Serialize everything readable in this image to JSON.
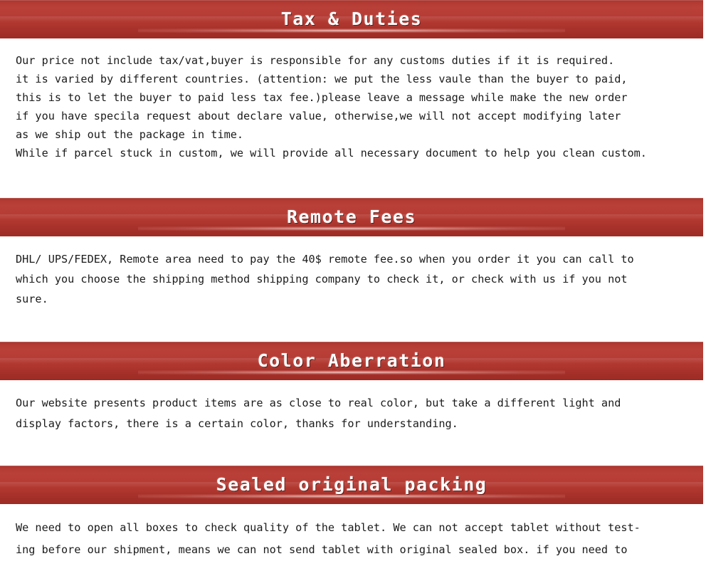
{
  "page": {
    "background_color": "#ffffff",
    "banner_color": "#b23a32",
    "banner_text_color": "#ffffff",
    "body_text_color": "#1b1b1b"
  },
  "sections": [
    {
      "id": "tax-and-duties",
      "title": "Tax & Duties",
      "lines": [
        "Our price not include tax/vat,buyer is responsible for any customs duties if it is required.",
        "it is varied by different countries. (attention: we put the less vaule than the buyer to paid,",
        "this is to let the buyer to paid less tax fee.)please leave a message while make the new order",
        "if you have specila request about declare value, otherwise,we will not accept modifying later",
        "as we ship out the package in time.",
        "While if parcel stuck in custom, we will provide all necessary document to help you clean custom."
      ]
    },
    {
      "id": "remote-fees",
      "title": "Remote Fees",
      "lines": [
        "DHL/ UPS/FEDEX, Remote area need to pay the 40$ remote fee.so when you order it you can call to",
        "which you choose the shipping method shipping company to check it, or check with us if you not",
        "sure."
      ]
    },
    {
      "id": "color-aberration",
      "title": "Color Aberration",
      "lines": [
        "Our website presents product items are as close to real color, but take a different light and",
        "display factors, there is a certain color, thanks for understanding."
      ]
    },
    {
      "id": "sealed-original-packing",
      "title": "Sealed original packing",
      "lines": [
        "We need to open all boxes to check quality of the tablet. We can not accept tablet without test-",
        "ing before our shipment, means we can not send tablet with original sealed box. if you need to"
      ]
    }
  ]
}
